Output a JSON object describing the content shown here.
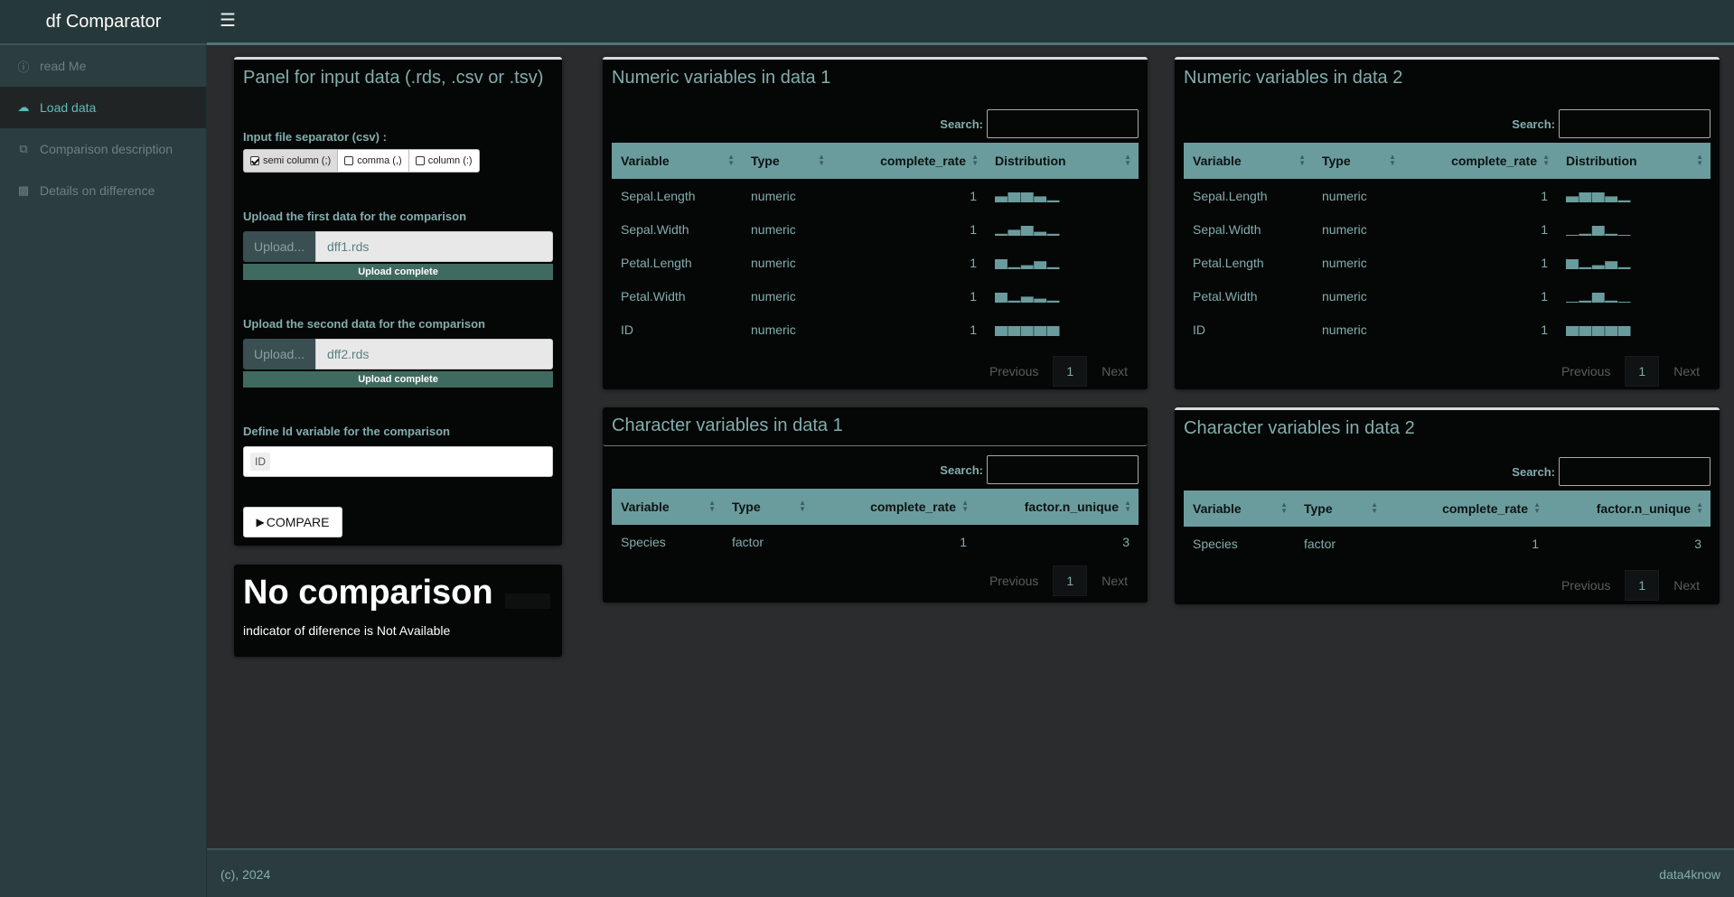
{
  "app": {
    "title": "df Comparator"
  },
  "sidebar": {
    "items": [
      {
        "label": "read Me",
        "icon": "info-icon"
      },
      {
        "label": "Load data",
        "icon": "cloud-upload-icon",
        "active": true
      },
      {
        "label": "Comparison description",
        "icon": "copy-icon"
      },
      {
        "label": "Details on difference",
        "icon": "book-icon"
      }
    ]
  },
  "input_panel": {
    "title": "Panel for input data (.rds, .csv or .tsv)",
    "separator_label": "Input file separator (csv) :",
    "separator_options": [
      {
        "label": "semi column (;)",
        "checked": true
      },
      {
        "label": "comma (,)",
        "checked": false
      },
      {
        "label": "column (:)",
        "checked": false
      }
    ],
    "upload1": {
      "label": "Upload the first data for the comparison",
      "button": "Upload...",
      "filename": "dff1.rds",
      "status": "Upload complete",
      "progress": 100
    },
    "upload2": {
      "label": "Upload the second data for the comparison",
      "button": "Upload...",
      "filename": "dff2.rds",
      "status": "Upload complete",
      "progress": 100
    },
    "id_label": "Define Id variable for the comparison",
    "id_value": "ID",
    "compare_button": "COMPARE"
  },
  "no_comparison": {
    "title": "No comparison",
    "subtitle": "indicator of diference is Not Available"
  },
  "tables": {
    "search_label": "Search:",
    "prev": "Previous",
    "next": "Next",
    "page": "1",
    "numeric1": {
      "title": "Numeric variables in data 1",
      "headers": [
        "Variable",
        "Type",
        "complete_rate",
        "Distribution"
      ],
      "rows": [
        [
          "Sepal.Length",
          "numeric",
          "1",
          [
            3,
            5,
            5,
            3,
            1
          ]
        ],
        [
          "Sepal.Width",
          "numeric",
          "1",
          [
            1,
            3,
            5,
            2,
            1
          ]
        ],
        [
          "Petal.Length",
          "numeric",
          "1",
          [
            5,
            1,
            2,
            4,
            1
          ]
        ],
        [
          "Petal.Width",
          "numeric",
          "1",
          [
            5,
            1,
            3,
            2,
            1
          ]
        ],
        [
          "ID",
          "numeric",
          "1",
          [
            5,
            5,
            5,
            5,
            5
          ]
        ]
      ]
    },
    "numeric2": {
      "title": "Numeric variables in data 2",
      "headers": [
        "Variable",
        "Type",
        "complete_rate",
        "Distribution"
      ],
      "rows": [
        [
          "Sepal.Length",
          "numeric",
          "1",
          [
            3,
            5,
            5,
            3,
            1
          ]
        ],
        [
          "Sepal.Width",
          "numeric",
          "1",
          [
            0,
            1,
            5,
            1,
            0
          ]
        ],
        [
          "Petal.Length",
          "numeric",
          "1",
          [
            5,
            1,
            2,
            4,
            1
          ]
        ],
        [
          "Petal.Width",
          "numeric",
          "1",
          [
            0,
            1,
            5,
            1,
            0
          ]
        ],
        [
          "ID",
          "numeric",
          "1",
          [
            5,
            5,
            5,
            5,
            5
          ]
        ]
      ]
    },
    "char1": {
      "title": "Character variables in data 1",
      "headers": [
        "Variable",
        "Type",
        "complete_rate",
        "factor.n_unique"
      ],
      "rows": [
        [
          "Species",
          "factor",
          "1",
          "3"
        ]
      ]
    },
    "char2": {
      "title": "Character variables in data 2",
      "headers": [
        "Variable",
        "Type",
        "complete_rate",
        "factor.n_unique"
      ],
      "rows": [
        [
          "Species",
          "factor",
          "1",
          "3"
        ]
      ]
    }
  },
  "footer": {
    "left": "(c), 2024",
    "right": "data4know"
  },
  "colors": {
    "accent": "#6b9c9d",
    "text_accent": "#83aeae",
    "progress": "#3f6a5f"
  }
}
